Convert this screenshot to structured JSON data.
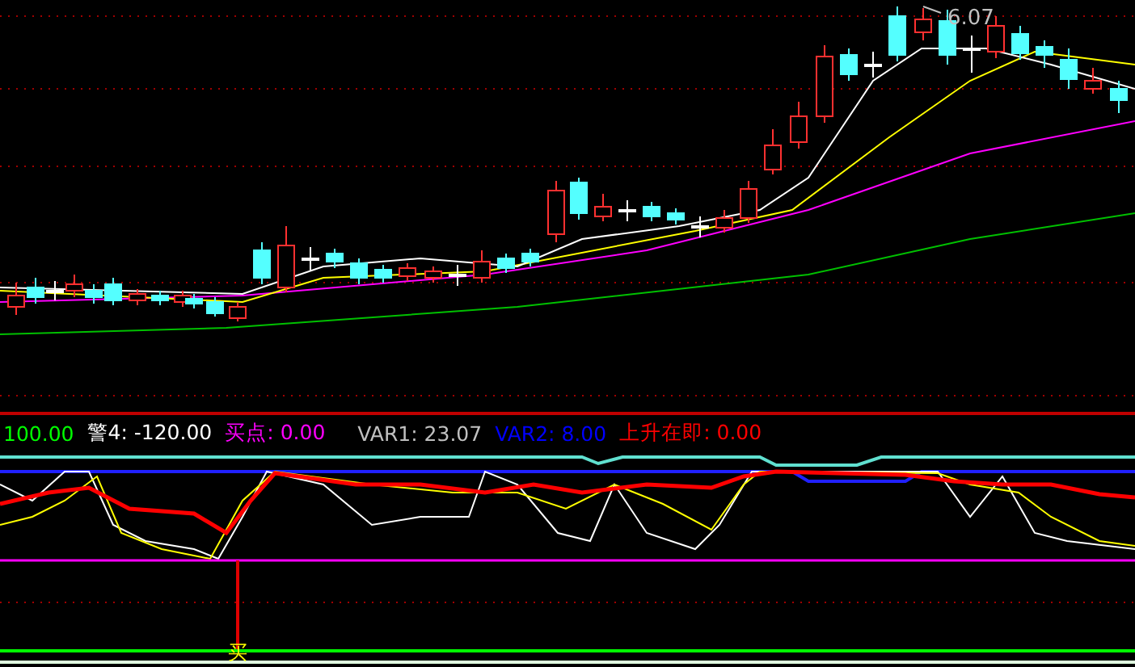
{
  "price_chart": {
    "high_label": "6.07"
  },
  "indicator_legend": [
    {
      "text": "100.00",
      "color": "#00ff00"
    },
    {
      "text": "警4: -120.00",
      "color": "#ffffff"
    },
    {
      "text": "买点: 0.00",
      "color": "#ff00ff"
    },
    {
      "text": "VAR1: 23.07",
      "color": "#c0c0c0"
    },
    {
      "text": "VAR2: 8.00",
      "color": "#0000ff"
    },
    {
      "text": "上升在即: 0.00",
      "color": "#ff0000"
    }
  ],
  "indicator_chart": {
    "signal_label": "买"
  }
}
